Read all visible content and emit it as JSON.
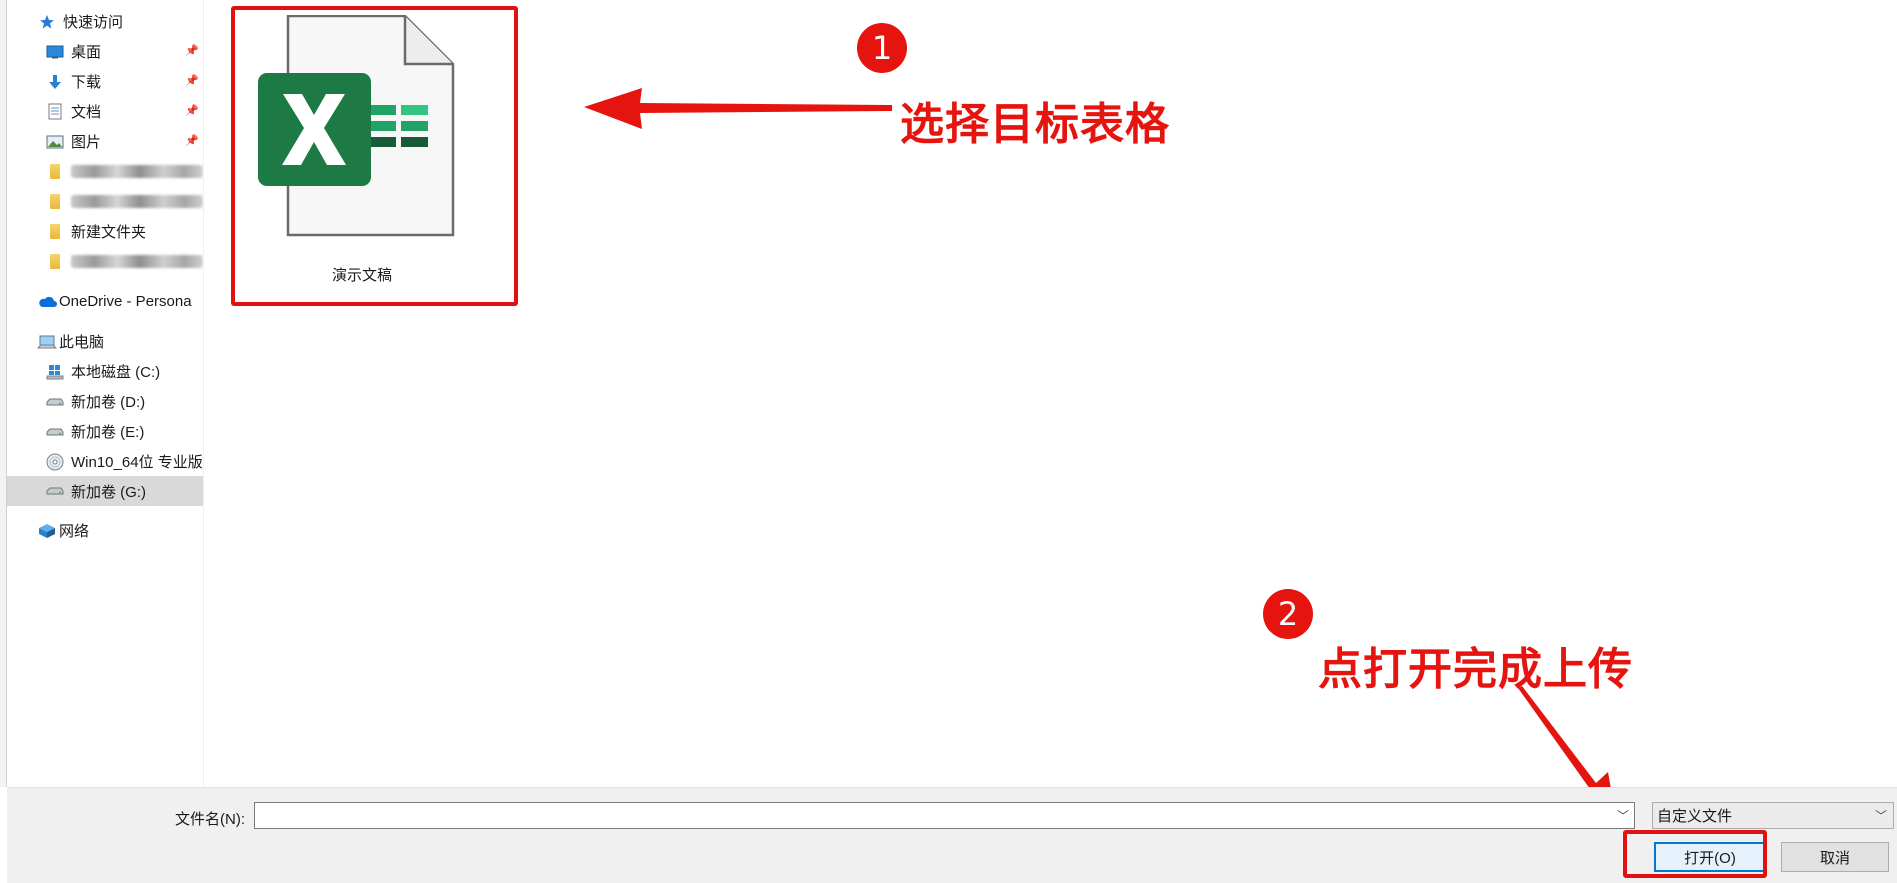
{
  "sidebar": {
    "quick_access": "快速访问",
    "pinned": [
      {
        "label": "桌面",
        "icon": "desktop-icon"
      },
      {
        "label": "下载",
        "icon": "download-icon"
      },
      {
        "label": "文档",
        "icon": "document-icon"
      },
      {
        "label": "图片",
        "icon": "pictures-icon"
      }
    ],
    "folder_new": "新建文件夹",
    "onedrive": "OneDrive - Persona",
    "this_pc": "此电脑",
    "drives": [
      {
        "label": "本地磁盘 (C:)",
        "icon": "windows-drive-icon"
      },
      {
        "label": "新加卷 (D:)",
        "icon": "drive-icon"
      },
      {
        "label": "新加卷 (E:)",
        "icon": "drive-icon"
      },
      {
        "label": "Win10_64位 专业版",
        "icon": "dvd-icon"
      },
      {
        "label": "新加卷 (G:)",
        "icon": "drive-icon",
        "selected": true
      }
    ],
    "network": "网络"
  },
  "content": {
    "file": {
      "name": "演示文稿",
      "icon": "excel-file-icon"
    }
  },
  "annotations": {
    "step1": {
      "number": "1",
      "text": "选择目标表格"
    },
    "step2": {
      "number": "2",
      "text": "点打开完成上传"
    },
    "color": "#e6140f"
  },
  "bottom": {
    "filename_label": "文件名(N):",
    "filename_value": "",
    "filter_value": "自定义文件",
    "open_label": "打开(O)",
    "cancel_label": "取消"
  }
}
